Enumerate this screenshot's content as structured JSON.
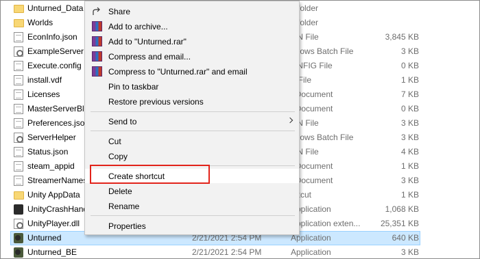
{
  "files": [
    {
      "name": "Unturned_Data",
      "date": "",
      "type": "e folder",
      "size": "",
      "icon": "folder-icon"
    },
    {
      "name": "Worlds",
      "date": "",
      "type": "e folder",
      "size": "",
      "icon": "folder-icon"
    },
    {
      "name": "EconInfo.json",
      "date": "",
      "type": "ON File",
      "size": "3,845 KB",
      "icon": "document-icon"
    },
    {
      "name": "ExampleServer",
      "date": "",
      "type": "ndows Batch File",
      "size": "3 KB",
      "icon": "gear-icon"
    },
    {
      "name": "Execute.config",
      "date": "",
      "type": "ONFIG File",
      "size": "0 KB",
      "icon": "document-icon"
    },
    {
      "name": "install.vdf",
      "date": "",
      "type": "F File",
      "size": "1 KB",
      "icon": "document-icon"
    },
    {
      "name": "Licenses",
      "date": "",
      "type": "t Document",
      "size": "7 KB",
      "icon": "document-icon"
    },
    {
      "name": "MasterServerBla",
      "date": "",
      "type": "t Document",
      "size": "0 KB",
      "icon": "document-icon"
    },
    {
      "name": "Preferences.json",
      "date": "",
      "type": "ON File",
      "size": "3 KB",
      "icon": "document-icon"
    },
    {
      "name": "ServerHelper",
      "date": "",
      "type": "ndows Batch File",
      "size": "3 KB",
      "icon": "gear-icon"
    },
    {
      "name": "Status.json",
      "date": "",
      "type": "ON File",
      "size": "4 KB",
      "icon": "document-icon"
    },
    {
      "name": "steam_appid",
      "date": "",
      "type": "t Document",
      "size": "1 KB",
      "icon": "document-icon"
    },
    {
      "name": "StreamerNames",
      "date": "",
      "type": "t Document",
      "size": "3 KB",
      "icon": "document-icon"
    },
    {
      "name": "Unity AppData",
      "date": "",
      "type": "ortcut",
      "size": "1 KB",
      "icon": "folder-icon"
    },
    {
      "name": "UnityCrashHand",
      "date": "",
      "type": "Application",
      "size": "1,068 KB",
      "icon": "unity-icon"
    },
    {
      "name": "UnityPlayer.dll",
      "date": "",
      "type": "Application exten...",
      "size": "25,351 KB",
      "icon": "gear-icon"
    },
    {
      "name": "Unturned",
      "date": "2/21/2021 2:54 PM",
      "type": "Application",
      "size": "640 KB",
      "icon": "game-icon",
      "selected": true
    },
    {
      "name": "Unturned_BE",
      "date": "2/21/2021 2:54 PM",
      "type": "Application",
      "size": "3 KB",
      "icon": "game-icon"
    }
  ],
  "menu": {
    "share": "Share",
    "add_archive": "Add to archive...",
    "add_rar": "Add to \"Unturned.rar\"",
    "compress_email": "Compress and email...",
    "compress_rar_email": "Compress to \"Unturned.rar\" and email",
    "pin_taskbar": "Pin to taskbar",
    "restore_versions": "Restore previous versions",
    "send_to": "Send to",
    "cut": "Cut",
    "copy": "Copy",
    "create_shortcut": "Create shortcut",
    "delete": "Delete",
    "rename": "Rename",
    "properties": "Properties"
  },
  "colors": {
    "selection": "#cce8ff",
    "highlight_box": "#e2231a",
    "menu_bg": "#f2f2f2"
  }
}
